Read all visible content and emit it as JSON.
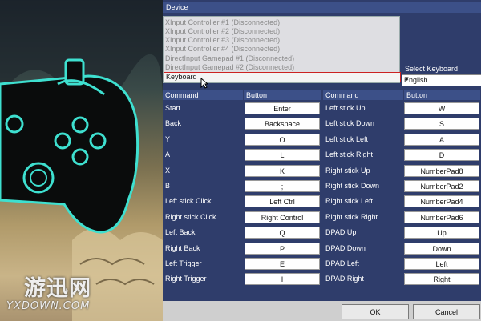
{
  "watermark": {
    "main": "游迅网",
    "sub": "YXDOWN.COM"
  },
  "device": {
    "header": "Device",
    "items": [
      "XInput Controller #1 (Disconnected)",
      "XInput Controller #2 (Disconnected)",
      "XInput Controller #3 (Disconnected)",
      "XInput Controller #4 (Disconnected)",
      "DirectInput Gamepad #1 (Disconnected)",
      "DirectInput Gamepad #2 (Disconnected)",
      "Keyboard"
    ],
    "selected": "Keyboard"
  },
  "layout": {
    "label": "Select Keyboard Layout",
    "value": "English"
  },
  "table": {
    "headers": [
      "Command",
      "Button",
      "Command",
      "Button"
    ],
    "left": [
      {
        "command": "Start",
        "button": "Enter"
      },
      {
        "command": "Back",
        "button": "Backspace"
      },
      {
        "command": "Y",
        "button": "O"
      },
      {
        "command": "A",
        "button": "L"
      },
      {
        "command": "X",
        "button": "K"
      },
      {
        "command": "B",
        "button": ";"
      },
      {
        "command": "Left stick Click",
        "button": "Left Ctrl"
      },
      {
        "command": "Right stick Click",
        "button": "Right Control"
      },
      {
        "command": "Left Back",
        "button": "Q"
      },
      {
        "command": "Right Back",
        "button": "P"
      },
      {
        "command": "Left Trigger",
        "button": "E"
      },
      {
        "command": "Right Trigger",
        "button": "I"
      }
    ],
    "right": [
      {
        "command": "Left stick Up",
        "button": "W"
      },
      {
        "command": "Left stick Down",
        "button": "S"
      },
      {
        "command": "Left stick Left",
        "button": "A"
      },
      {
        "command": "Left stick Right",
        "button": "D"
      },
      {
        "command": "Right stick Up",
        "button": "NumberPad8"
      },
      {
        "command": "Right stick Down",
        "button": "NumberPad2"
      },
      {
        "command": "Right stick Left",
        "button": "NumberPad4"
      },
      {
        "command": "Right stick Right",
        "button": "NumberPad6"
      },
      {
        "command": "DPAD Up",
        "button": "Up"
      },
      {
        "command": "DPAD Down",
        "button": "Down"
      },
      {
        "command": "DPAD Left",
        "button": "Left"
      },
      {
        "command": "DPAD Right",
        "button": "Right"
      }
    ]
  },
  "buttons": {
    "ok": "OK",
    "cancel": "Cancel"
  },
  "colors": {
    "panel": "#2f3d6b",
    "header": "#3c5088",
    "controller_outline": "#3ee0d0",
    "selected_border": "#cc2222"
  }
}
